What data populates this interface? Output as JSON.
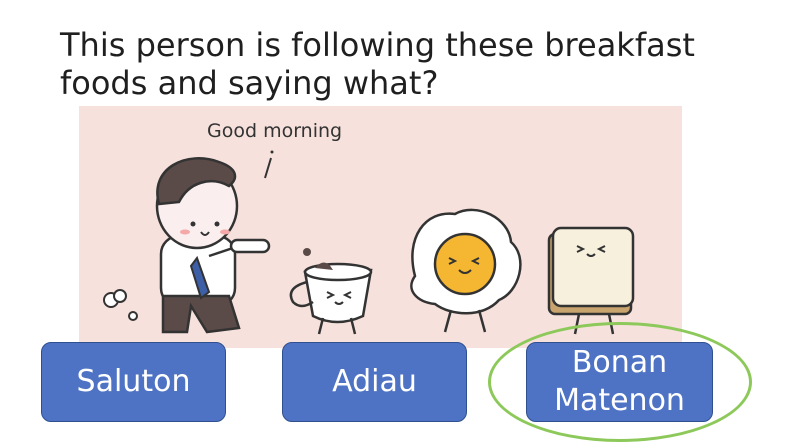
{
  "question": {
    "text": "This person is following these breakfast foods and saying what?"
  },
  "illustration": {
    "speech_text": "Good morning"
  },
  "answers": [
    {
      "label": "Saluton"
    },
    {
      "label": "Adiau"
    },
    {
      "label_line1": "Bonan",
      "label_line2": "Matenon"
    }
  ],
  "colors": {
    "button_fill": "#4e73c4",
    "highlight_ring": "#8dc95a",
    "illustration_bg": "#f6e1dc"
  },
  "highlighted_answer": "Bonan Matenon"
}
